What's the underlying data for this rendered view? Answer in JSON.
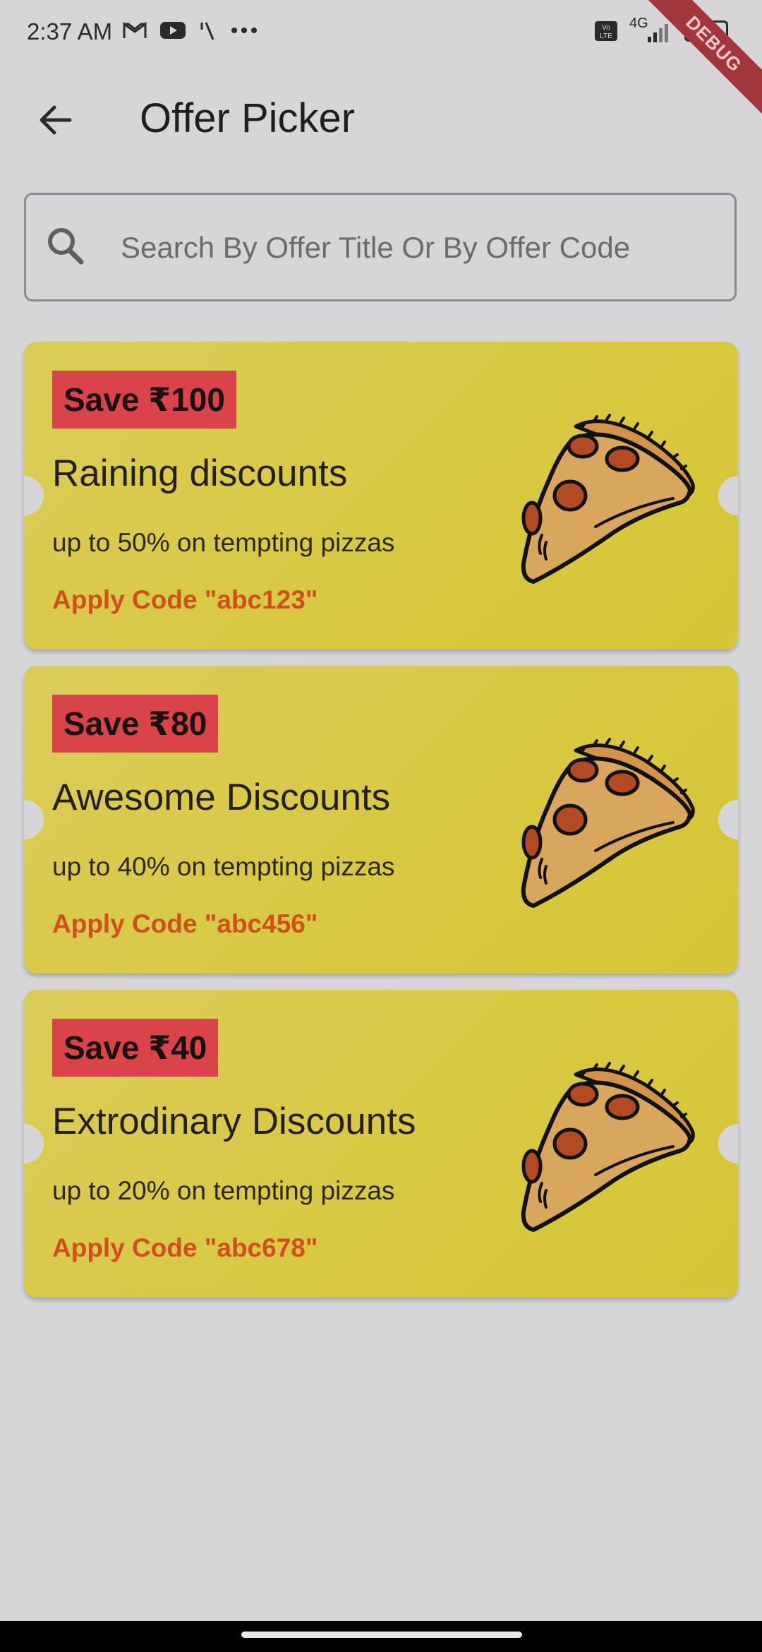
{
  "status_bar": {
    "time": "2:37 AM",
    "network": "4G",
    "network_secondary": "4G",
    "debug_label": "DEBUG"
  },
  "app_bar": {
    "title": "Offer Picker"
  },
  "search": {
    "placeholder": "Search By Offer Title Or By Offer Code"
  },
  "offers": [
    {
      "badge": "Save ₹100",
      "title": "Raining discounts",
      "description": "up to 50% on tempting pizzas",
      "code_label": "Apply Code \"abc123\""
    },
    {
      "badge": "Save ₹80",
      "title": "Awesome Discounts",
      "description": "up to 40% on tempting pizzas",
      "code_label": "Apply Code \"abc456\""
    },
    {
      "badge": "Save ₹40",
      "title": "Extrodinary Discounts",
      "description": "up to 20% on tempting pizzas",
      "code_label": "Apply Code \"abc678\""
    }
  ],
  "colors": {
    "background": "#d6d6d9",
    "card": "#d8c942",
    "badge": "#d84449",
    "code_text": "#cf4f1e",
    "debug_ribbon": "#a1363b"
  },
  "icons": {
    "back": "arrow-left-icon",
    "search": "search-icon",
    "offer_image": "pizza-slice-icon"
  }
}
